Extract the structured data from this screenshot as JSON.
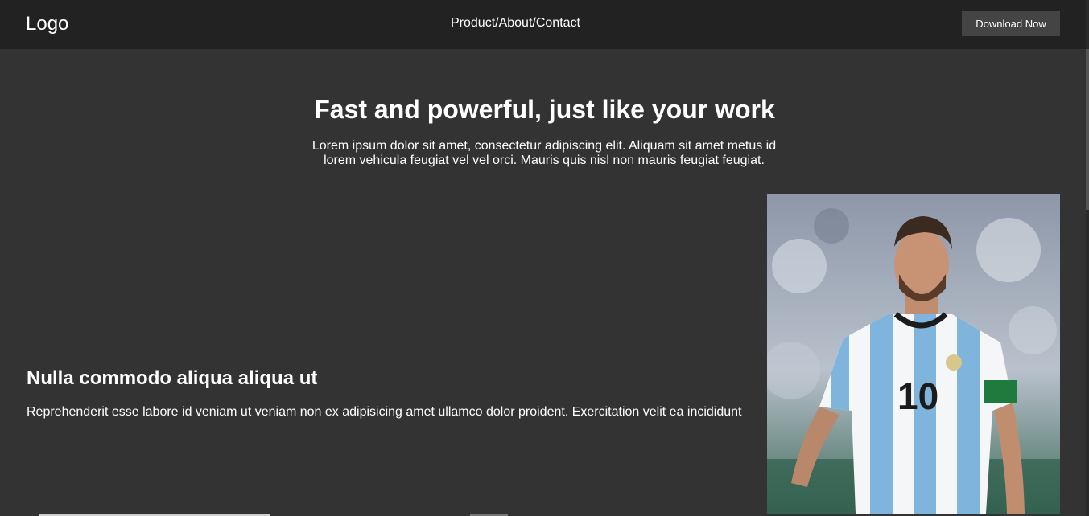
{
  "navbar": {
    "logo": "Logo",
    "links": "Product/About/Contact",
    "cta_label": "Download Now"
  },
  "hero": {
    "title": "Fast and powerful, just like your work",
    "subtitle": "Lorem ipsum dolor sit amet, consectetur adipiscing elit. Aliquam sit amet metus id lorem vehicula feugiat vel vel orci. Mauris quis nisl non mauris feugiat feugiat."
  },
  "feature": {
    "title": "Nulla commodo aliqua aliqua ut",
    "text": "Reprehenderit esse labore id veniam ut veniam non ex adipisicing amet ullamco dolor proident. Exercitation velit ea incididunt"
  },
  "image": {
    "jersey_number": "10"
  },
  "colors": {
    "page_bg": "#333333",
    "navbar_bg": "#222222",
    "button_bg": "#444444",
    "text": "#ffffff"
  }
}
